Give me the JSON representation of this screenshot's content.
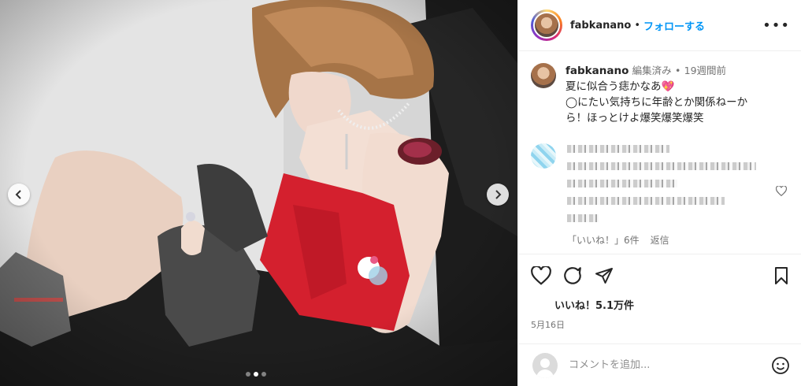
{
  "post": {
    "username": "fabkanano",
    "follow_label": "フォローする",
    "header_separator": "•"
  },
  "caption": {
    "username": "fabkanano",
    "edited": "編集済み",
    "separator": "•",
    "time_ago": "19週間前",
    "line1": "夏に似合う痣かなあ💖",
    "line2": "◯にたい気持ちに年齢とか関係ねーか",
    "line3": "ら！ほっとけよ爆笑爆笑爆笑"
  },
  "comment": {
    "likes_label": "「いいね！」6件",
    "reply_label": "返信"
  },
  "stats": {
    "likes": "いいね！5.1万件",
    "date": "5月16日"
  },
  "comment_box": {
    "placeholder": "コメントを追加..."
  },
  "carousel": {
    "total_slides": 3,
    "active_slide": 2
  },
  "colors": {
    "link_blue": "#0095f6",
    "text": "#262626",
    "secondary": "#737373",
    "heart_pink": "#e0245e"
  }
}
